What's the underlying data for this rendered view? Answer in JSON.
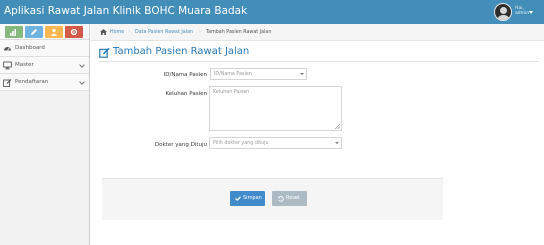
{
  "app": {
    "title": "Aplikasi Rawat Jalan Klinik BOHC Muara Badak"
  },
  "user": {
    "greeting": "Hai,",
    "name": "admin"
  },
  "colors": {
    "navbar": "#438eb9",
    "shortcut_success": "#87b87f",
    "shortcut_info": "#6fb3e0",
    "shortcut_warning": "#ffb752",
    "shortcut_danger": "#d15b47",
    "title": "#2679b5",
    "primary_button": "#428bca",
    "secondary_button": "#abbac3"
  },
  "shortcuts": [
    {
      "icon": "signal-icon",
      "color": "#87b87f"
    },
    {
      "icon": "pencil-icon",
      "color": "#6fb3e0"
    },
    {
      "icon": "group-icon",
      "color": "#ffb752"
    },
    {
      "icon": "cogs-icon",
      "color": "#d15b47"
    }
  ],
  "sidebar": {
    "items": [
      {
        "label": "Dashboard",
        "icon": "dashboard-icon",
        "has_submenu": false
      },
      {
        "label": "Master",
        "icon": "desktop-icon",
        "has_submenu": true
      },
      {
        "label": "Pendaftaran",
        "icon": "edit-icon",
        "has_submenu": true
      }
    ]
  },
  "breadcrumb": {
    "home": "Home",
    "parent": "Data Pasien Rawat Jalan",
    "current": "Tambah Pasien Rawat Jalan"
  },
  "page": {
    "title": "Tambah Pasien Rawat Jalan",
    "title_icon": "edit-icon"
  },
  "form": {
    "patient": {
      "label": "ID/Nama Pasien",
      "placeholder": "ID/Nama Pasien"
    },
    "complaint": {
      "label": "Keluhan Pasien",
      "placeholder": "Keluhan Pasien"
    },
    "doctor": {
      "label": "Dokter yang Dituju",
      "placeholder": "Pilih dokter yang dituju"
    },
    "actions": {
      "save": "Simpan",
      "reset": "Reset"
    }
  }
}
